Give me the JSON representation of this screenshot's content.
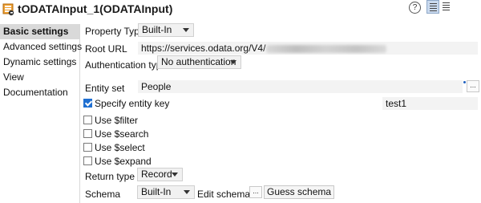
{
  "header": {
    "title": "tODATAInput_1(ODATAInput)",
    "help_icon": "?",
    "icons": [
      "component-icon",
      "help-icon",
      "list-view-icon",
      "table-view-icon"
    ]
  },
  "sidebar": {
    "items": [
      {
        "label": "Basic settings",
        "active": true
      },
      {
        "label": "Advanced settings",
        "active": false
      },
      {
        "label": "Dynamic settings",
        "active": false
      },
      {
        "label": "View",
        "active": false
      },
      {
        "label": "Documentation",
        "active": false
      }
    ]
  },
  "form": {
    "property_type": {
      "label": "Property Type",
      "value": "Built-In"
    },
    "root_url": {
      "label": "Root URL",
      "value": "https://services.odata.org/V4/"
    },
    "authentication_type": {
      "label": "Authentication type",
      "value": "No authentication"
    },
    "entity_set": {
      "label": "Entity set",
      "value": "People",
      "button": "..."
    },
    "specify_entity_key": {
      "label": "Specify entity key",
      "checked": true,
      "value": "test1"
    },
    "use_filter": {
      "label": "Use $filter",
      "checked": false
    },
    "use_search": {
      "label": "Use $search",
      "checked": false
    },
    "use_select": {
      "label": "Use $select",
      "checked": false
    },
    "use_expand": {
      "label": "Use $expand",
      "checked": false
    },
    "return_type": {
      "label": "Return type",
      "value": "Record"
    },
    "schema": {
      "label": "Schema",
      "value": "Built-In",
      "edit_label": "Edit schema",
      "edit_button": "...",
      "guess_button": "Guess schema"
    }
  },
  "colors": {
    "accent": "#1f6fd1",
    "sidebar_active": "#d9d9d9",
    "field_bg": "#f3f3f3"
  }
}
